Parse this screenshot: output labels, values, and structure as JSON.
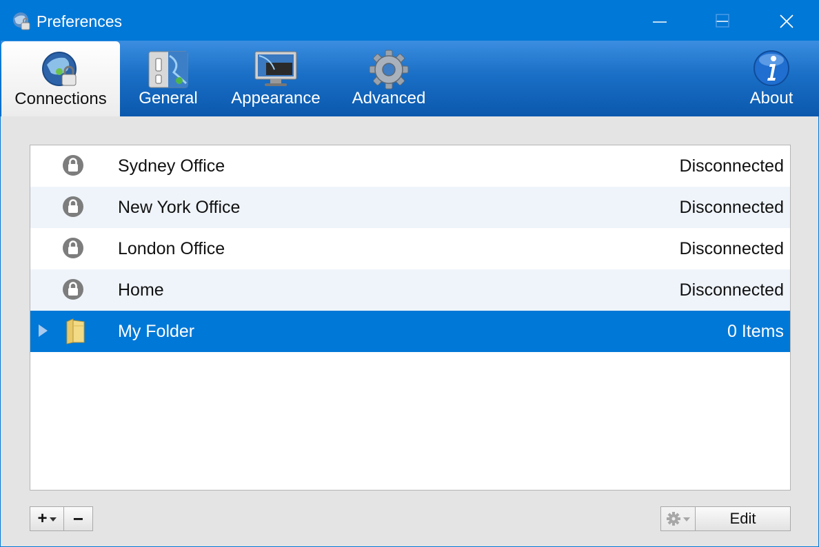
{
  "window": {
    "title": "Preferences",
    "controls": [
      "minimize-icon",
      "maximize-icon",
      "close-icon"
    ]
  },
  "toolbar": {
    "tabs": [
      {
        "label": "Connections",
        "icon": "globe-lock-icon",
        "active": true
      },
      {
        "label": "General",
        "icon": "switch-panel-icon",
        "active": false
      },
      {
        "label": "Appearance",
        "icon": "monitor-icon",
        "active": false
      },
      {
        "label": "Advanced",
        "icon": "gear-icon",
        "active": false
      }
    ],
    "about": {
      "label": "About",
      "icon": "info-icon"
    }
  },
  "connections": {
    "rows": [
      {
        "name": "Sydney Office",
        "status": "Disconnected",
        "icon": "lock-icon"
      },
      {
        "name": "New York Office",
        "status": "Disconnected",
        "icon": "lock-icon"
      },
      {
        "name": "London Office",
        "status": "Disconnected",
        "icon": "lock-icon"
      },
      {
        "name": "Home",
        "status": "Disconnected",
        "icon": "lock-icon"
      },
      {
        "name": "My Folder",
        "status": "0 Items",
        "icon": "folder-icon",
        "selected": true
      }
    ]
  },
  "buttons": {
    "add": "+",
    "remove": "−",
    "edit": "Edit"
  },
  "colors": {
    "accent": "#0078d7",
    "selected_row": "#0078d7",
    "alt_row": "#eff4fa"
  }
}
